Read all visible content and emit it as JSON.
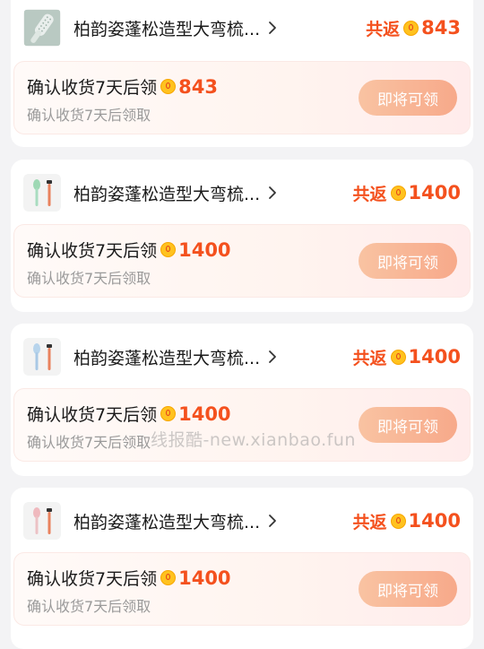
{
  "cards": [
    {
      "thumb_icon": "hair-brush-icon",
      "title": "柏韵姿蓬松造型大弯梳...",
      "total_label": "共返",
      "total_amount": "843",
      "confirm_text": "确认收货7天后领",
      "confirm_amount": "843",
      "sub_text": "确认收货7天后领取",
      "button_label": "即将可领"
    },
    {
      "thumb_icon": "brush-set-icon",
      "title": "柏韵姿蓬松造型大弯梳...",
      "total_label": "共返",
      "total_amount": "1400",
      "confirm_text": "确认收货7天后领",
      "confirm_amount": "1400",
      "sub_text": "确认收货7天后领取",
      "button_label": "即将可领"
    },
    {
      "thumb_icon": "brush-set-icon",
      "title": "柏韵姿蓬松造型大弯梳...",
      "total_label": "共返",
      "total_amount": "1400",
      "confirm_text": "确认收货7天后领",
      "confirm_amount": "1400",
      "sub_text": "确认收货7天后领取",
      "button_label": "即将可领"
    },
    {
      "thumb_icon": "brush-set-icon",
      "title": "柏韵姿蓬松造型大弯梳...",
      "total_label": "共返",
      "total_amount": "1400",
      "confirm_text": "确认收货7天后领",
      "confirm_amount": "1400",
      "sub_text": "确认收货7天后领取",
      "button_label": "即将可领"
    }
  ],
  "colors": {
    "accent": "#f4511e",
    "button": "#f7b092",
    "coin": "#ffc21f"
  },
  "watermark": "线报酷-new.xianbao.fun"
}
